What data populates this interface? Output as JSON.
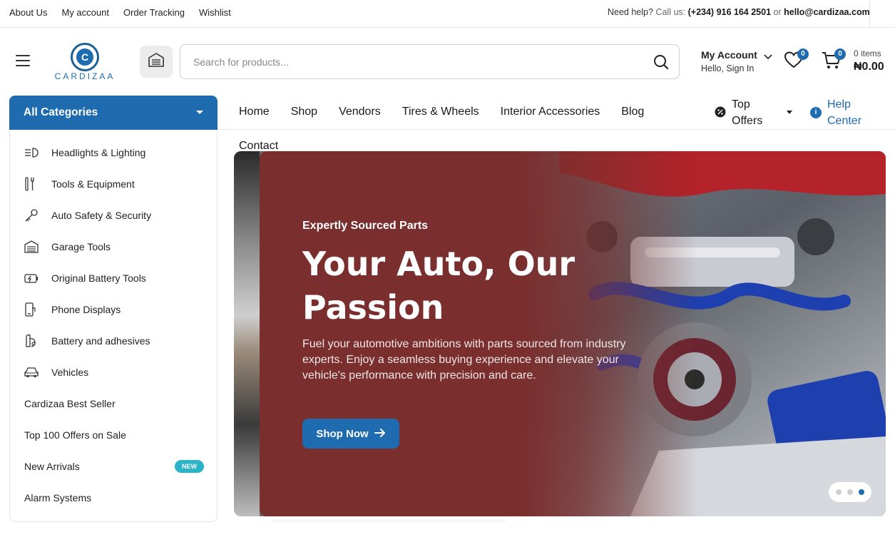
{
  "topbar": {
    "links": [
      "About Us",
      "My account",
      "Order Tracking",
      "Wishlist"
    ],
    "help_prefix": "Need help?",
    "call_label": "Call us:",
    "phone": "(+234) 916 164 2501",
    "or": "or",
    "email": "hello@cardizaa.com"
  },
  "logo": {
    "mark": "C",
    "wordmark": "CARDIZAA"
  },
  "search": {
    "placeholder": "Search for products..."
  },
  "account": {
    "title": "My Account",
    "subtitle": "Hello, Sign In"
  },
  "wishlist": {
    "count": "0"
  },
  "cart": {
    "count": "0",
    "items_label": "0 items",
    "total": "₦0.00"
  },
  "nav": {
    "all_categories": "All Categories",
    "menu": [
      "Home",
      "Shop",
      "Vendors",
      "Tires & Wheels",
      "Interior Accessories",
      "Blog"
    ],
    "contact": "Contact",
    "top_offers": "Top Offers",
    "help_center": "Help Center"
  },
  "sidebar": {
    "categories": [
      {
        "label": "Headlights & Lighting",
        "icon": "headlight-icon"
      },
      {
        "label": "Tools & Equipment",
        "icon": "tools-icon"
      },
      {
        "label": "Auto Safety & Security",
        "icon": "key-icon"
      },
      {
        "label": "Garage Tools",
        "icon": "garage-icon"
      },
      {
        "label": "Original Battery Tools",
        "icon": "battery-icon"
      },
      {
        "label": "Phone Displays",
        "icon": "phone-display-icon"
      },
      {
        "label": "Battery and adhesives",
        "icon": "adhesive-icon"
      },
      {
        "label": "Vehicles",
        "icon": "car-icon"
      }
    ],
    "extras": [
      "Cardizaa Best Seller",
      "Top 100 Offers on Sale",
      "New Arrivals",
      "Alarm Systems"
    ],
    "new_badge": "NEW"
  },
  "hero": {
    "kicker": "Expertly Sourced Parts",
    "title": "Your Auto, Our Passion",
    "description": "Fuel your automotive ambitions with parts sourced from industry experts. Enjoy a seamless buying experience and elevate your vehicle's performance with precision and care.",
    "button": "Shop Now",
    "slides": 3,
    "active_slide": 3
  },
  "colors": {
    "brand": "#1e6bb0",
    "hero_panel": "#7a2f2e",
    "new_badge": "#2bb3c7"
  }
}
